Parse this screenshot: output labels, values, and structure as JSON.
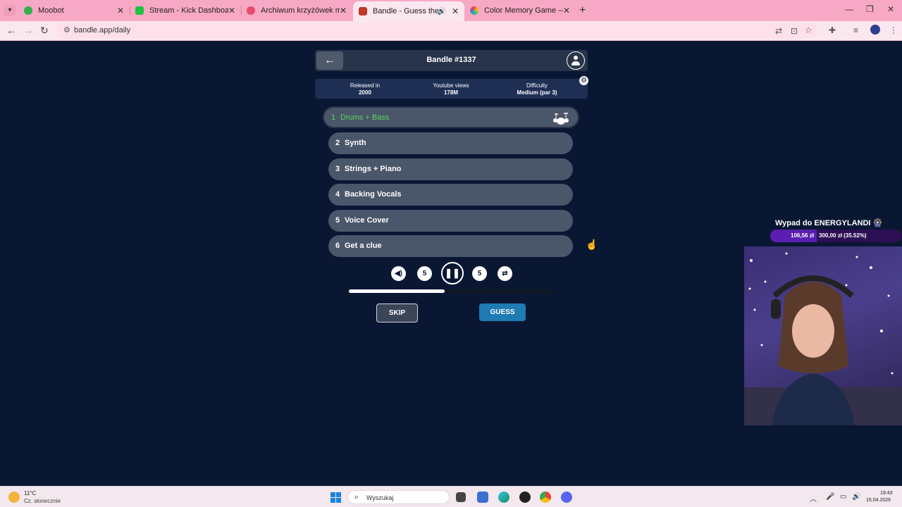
{
  "browser": {
    "tabs": [
      {
        "title": "Moobot",
        "favicon_color": "#2fb34a"
      },
      {
        "title": "Stream - Kick Dashboard",
        "favicon_color": "#1bc33e"
      },
      {
        "title": "Archiwum krzyżówek muzyczn",
        "favicon_color": "#e84a6b"
      },
      {
        "title": "Bandle - Guess the song, cr",
        "favicon_color": "#c0392b"
      },
      {
        "title": "Color Memory Game — How W",
        "favicon_color": "#e27bd3"
      }
    ],
    "active_tab": 3,
    "url": "bandle.app/daily"
  },
  "game": {
    "title": "Bandle #1337",
    "info": [
      {
        "label": "Released in",
        "value": "2000"
      },
      {
        "label": "Youtube views",
        "value": "178M"
      },
      {
        "label": "Difficulty",
        "value": "Medium (par 3)"
      }
    ],
    "stems": [
      {
        "num": "1",
        "label": "Drums + Bass"
      },
      {
        "num": "2",
        "label": "Synth"
      },
      {
        "num": "3",
        "label": "Strings + Piano"
      },
      {
        "num": "4",
        "label": "Backing Vocals"
      },
      {
        "num": "5",
        "label": "Voice Cover"
      },
      {
        "num": "6",
        "label": "Get a clue"
      }
    ],
    "current_stem": 1,
    "controls": {
      "rewind_label": "5",
      "forward_label": "5"
    },
    "progress": 0.47,
    "skip_label": "SKIP",
    "guess_label": "GUESS"
  },
  "overlay": {
    "goal_title": "Wypad do ENERGYLANDI",
    "goal_current": "106,56 zł",
    "goal_total": "300,00 zł (35.52%)",
    "goal_fraction": 0.3552
  },
  "taskbar": {
    "temperature": "11°C",
    "weather": "Cz. słonecznie",
    "search_placeholder": "Wyszukaj",
    "time": "19:43",
    "date": "15.04.2026"
  }
}
